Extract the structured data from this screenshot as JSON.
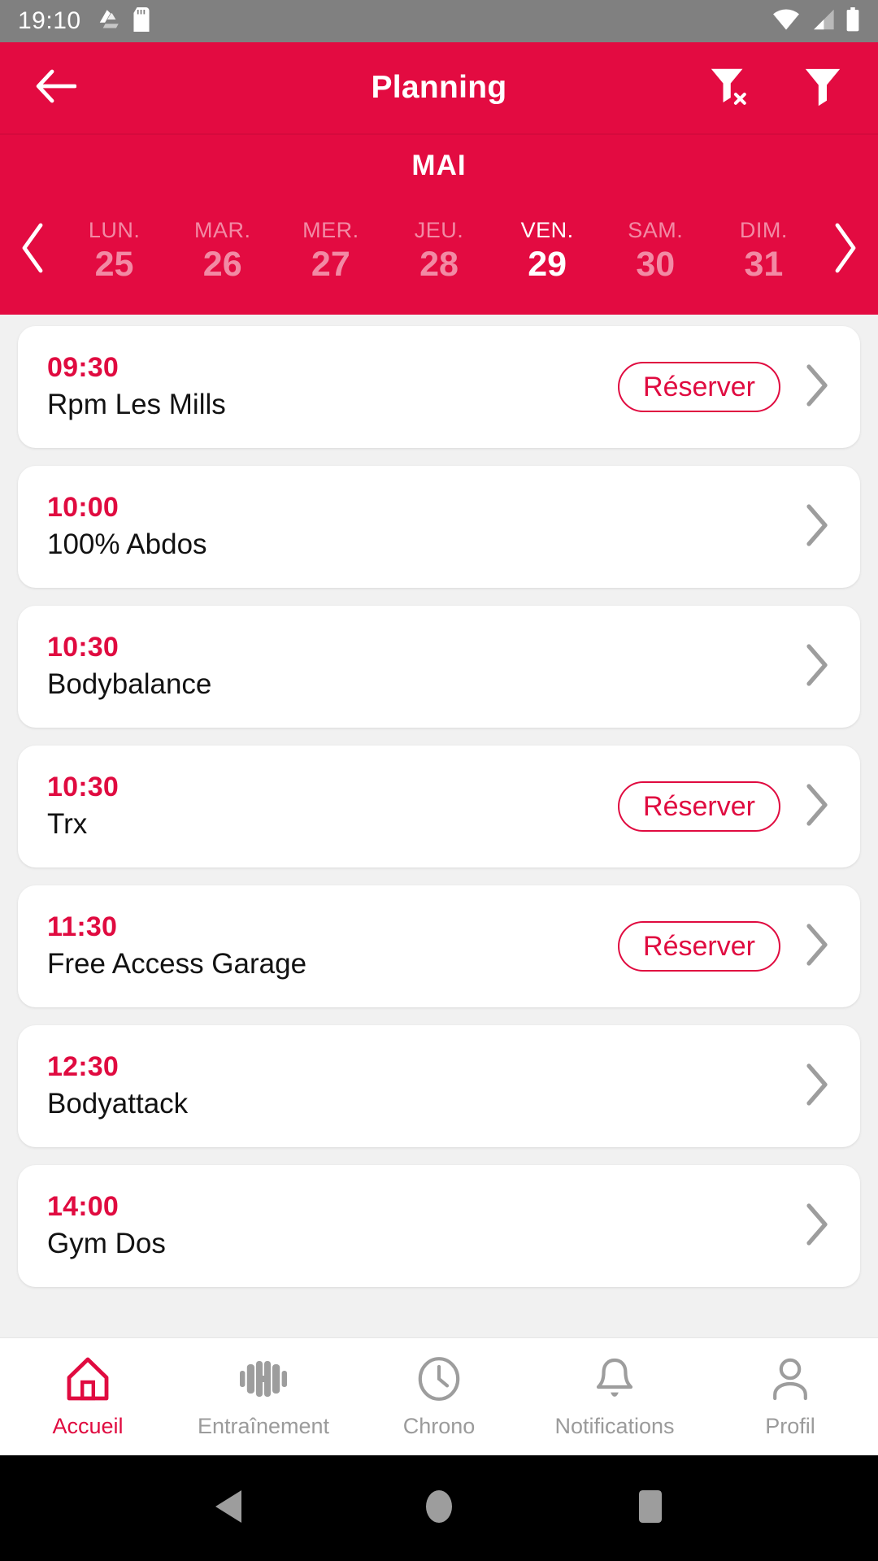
{
  "status_bar": {
    "time": "19:10",
    "left_icons": [
      "google-drive-icon",
      "sd-card-icon"
    ],
    "right_icons": [
      "wifi-icon",
      "cellular-signal-icon",
      "battery-icon"
    ],
    "background_color": "#808080"
  },
  "app_bar": {
    "back_icon": "back-arrow-icon",
    "title": "Planning",
    "actions": [
      "filter-clear-icon",
      "filter-icon"
    ],
    "background_color": "#e30b41"
  },
  "date_strip": {
    "month": "MAI",
    "prev_icon": "chevron-left-icon",
    "next_icon": "chevron-right-icon",
    "days": [
      {
        "name": "LUN.",
        "num": "25",
        "selected": false
      },
      {
        "name": "MAR.",
        "num": "26",
        "selected": false
      },
      {
        "name": "MER.",
        "num": "27",
        "selected": false
      },
      {
        "name": "JEU.",
        "num": "28",
        "selected": false
      },
      {
        "name": "VEN.",
        "num": "29",
        "selected": true
      },
      {
        "name": "SAM.",
        "num": "30",
        "selected": false
      },
      {
        "name": "DIM.",
        "num": "31",
        "selected": false
      }
    ]
  },
  "classes": {
    "book_label": "Réserver",
    "chevron_icon": "chevron-right-icon",
    "items": [
      {
        "time": "09:30",
        "name": "Rpm Les Mills",
        "bookable": true
      },
      {
        "time": "10:00",
        "name": "100% Abdos",
        "bookable": false
      },
      {
        "time": "10:30",
        "name": "Bodybalance",
        "bookable": false
      },
      {
        "time": "10:30",
        "name": "Trx",
        "bookable": true
      },
      {
        "time": "11:30",
        "name": "Free Access Garage",
        "bookable": true
      },
      {
        "time": "12:30",
        "name": "Bodyattack",
        "bookable": false
      },
      {
        "time": "14:00",
        "name": "Gym Dos",
        "bookable": false
      }
    ]
  },
  "bottom_nav": {
    "items": [
      {
        "label": "Accueil",
        "icon": "home-icon",
        "active": true
      },
      {
        "label": "Entraînement",
        "icon": "dumbbell-icon",
        "active": false
      },
      {
        "label": "Chrono",
        "icon": "clock-icon",
        "active": false
      },
      {
        "label": "Notifications",
        "icon": "bell-icon",
        "active": false
      },
      {
        "label": "Profil",
        "icon": "person-icon",
        "active": false
      }
    ]
  },
  "soft_keys": {
    "items": [
      "back-triangle-icon",
      "home-circle-icon",
      "recents-square-icon"
    ]
  },
  "colors": {
    "brand_red": "#e00b40",
    "header_red": "#e30b41",
    "page_background": "#f1f1f1",
    "status_bar_gray": "#808080",
    "inactive_gray": "#9b9b9b"
  }
}
